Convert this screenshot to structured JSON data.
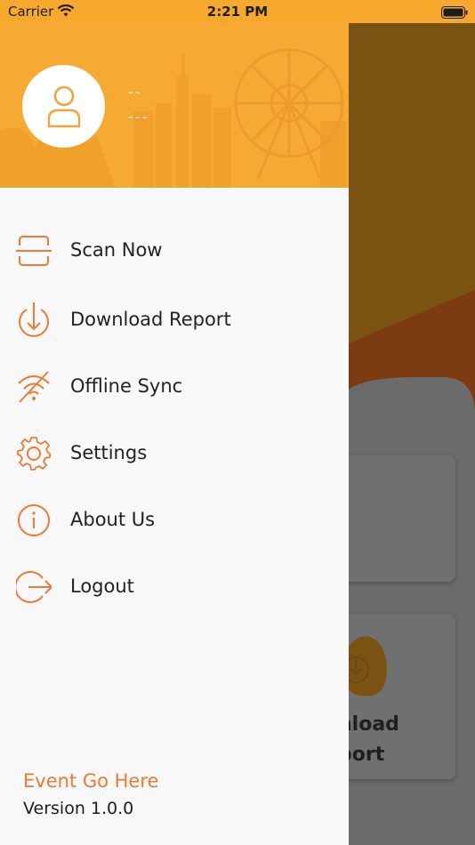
{
  "status_bar": {
    "carrier": "Carrier",
    "time": "2:21 PM",
    "wifi_icon": "wifi-icon",
    "battery_icon": "battery-icon"
  },
  "drawer": {
    "header": {
      "user_name": "--",
      "user_detail": "---",
      "avatar_icon": "user-icon"
    },
    "menu": [
      {
        "label": "Scan Now",
        "icon": "scan-icon"
      },
      {
        "label": "Download Report",
        "icon": "download-icon"
      },
      {
        "label": "Offline Sync",
        "icon": "offline-sync-icon"
      },
      {
        "label": "Settings",
        "icon": "gear-icon"
      },
      {
        "label": "About Us",
        "icon": "info-icon"
      },
      {
        "label": "Logout",
        "icon": "logout-icon"
      }
    ],
    "footer": {
      "event": "Event Go Here",
      "version": "Version 1.0.0"
    }
  },
  "background_screen": {
    "card_label_line1": "nload",
    "card_label_line2": "port"
  },
  "colors": {
    "header": "#f7aa33",
    "accent": "#ec7a35",
    "drawer_bg": "#f8f8f8"
  }
}
